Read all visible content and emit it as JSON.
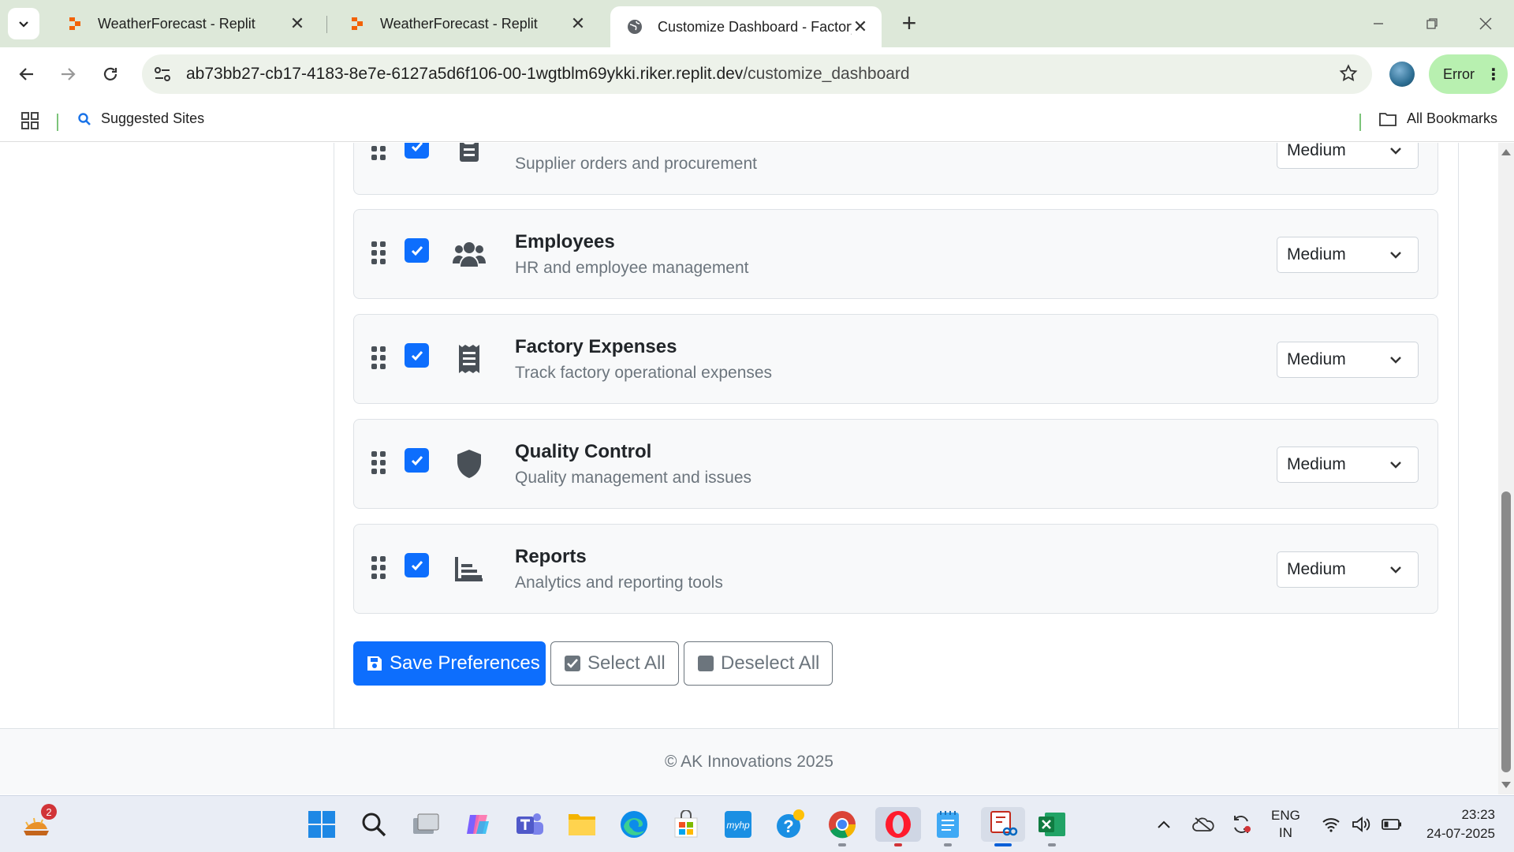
{
  "browser": {
    "tabs": [
      {
        "title": "WeatherForecast - Replit",
        "active": false
      },
      {
        "title": "WeatherForecast - Replit",
        "active": false
      },
      {
        "title": "Customize Dashboard - Factory",
        "active": true
      }
    ],
    "url_host": "ab73bb27-cb17-4183-8e7e-6127a5d6f106-00-1wgtblm69ykki.riker.replit.dev",
    "url_path": "/customize_dashboard",
    "error_label": "Error",
    "bookmarks": {
      "suggested_sites": "Suggested Sites",
      "all_bookmarks": "All Bookmarks"
    }
  },
  "modules": [
    {
      "title": "",
      "description": "Supplier orders and procurement",
      "icon": "clipboard-icon",
      "size": "Medium",
      "checked": true
    },
    {
      "title": "Employees",
      "description": "HR and employee management",
      "icon": "users-icon",
      "size": "Medium",
      "checked": true
    },
    {
      "title": "Factory Expenses",
      "description": "Track factory operational expenses",
      "icon": "receipt-icon",
      "size": "Medium",
      "checked": true
    },
    {
      "title": "Quality Control",
      "description": "Quality management and issues",
      "icon": "shield-icon",
      "size": "Medium",
      "checked": true
    },
    {
      "title": "Reports",
      "description": "Analytics and reporting tools",
      "icon": "chart-bar-icon",
      "size": "Medium",
      "checked": true
    }
  ],
  "actions": {
    "save": "Save Preferences",
    "select_all": "Select All",
    "deselect_all": "Deselect All"
  },
  "footer": {
    "copyright": "© AK Innovations 2025"
  },
  "taskbar": {
    "notification_badge": "2",
    "language": "ENG",
    "region": "IN",
    "time": "23:23",
    "date": "24-07-2025"
  },
  "colors": {
    "primary": "#0d6efd",
    "muted_text": "#6c757d",
    "error_chip": "#b8f0b0"
  }
}
